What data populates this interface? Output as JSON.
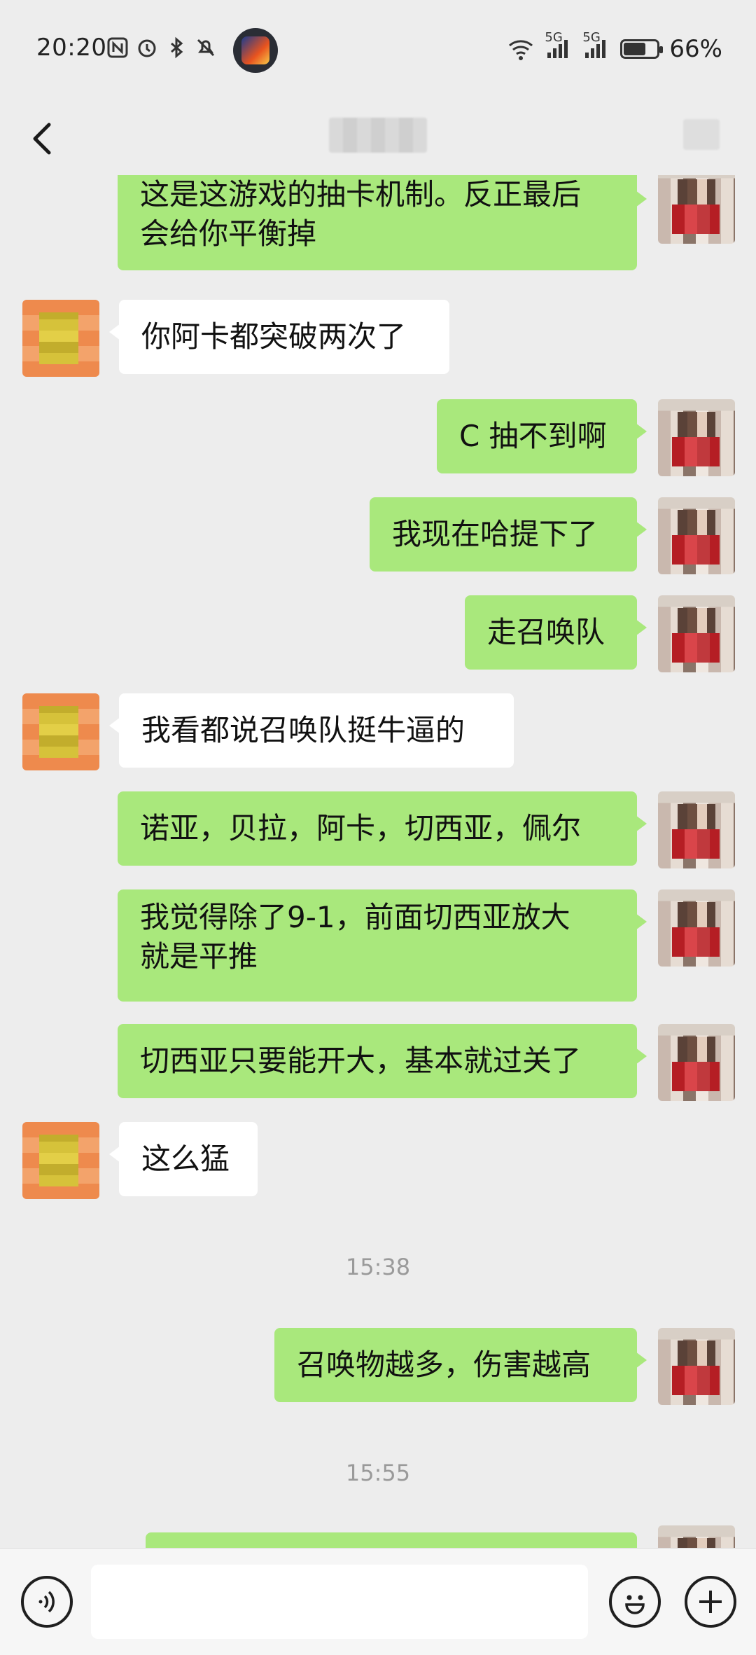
{
  "status_bar": {
    "time": "20:20",
    "battery": "66%",
    "battery_level": 0.66,
    "network_labels": [
      "5G",
      "5G"
    ],
    "icons": [
      "nfc-icon",
      "alarm-icon",
      "bluetooth-icon",
      "mute-icon",
      "wifi-icon",
      "signal-icon",
      "signal-icon",
      "battery-icon"
    ]
  },
  "header": {
    "title": "",
    "back_icon": "chevron-left-icon",
    "menu_icon": "more-icon"
  },
  "messages": [
    {
      "side": "out",
      "lines": [
        "这是这游戏的抽卡机制。反正最后",
        "会给你平衡掉"
      ]
    },
    {
      "side": "in",
      "lines": [
        "你阿卡都突破两次了"
      ]
    },
    {
      "side": "out",
      "lines": [
        "C 抽不到啊"
      ]
    },
    {
      "side": "out",
      "lines": [
        "我现在哈提下了"
      ]
    },
    {
      "side": "out",
      "lines": [
        "走召唤队"
      ]
    },
    {
      "side": "in",
      "lines": [
        "我看都说召唤队挺牛逼的"
      ]
    },
    {
      "side": "out",
      "lines": [
        "诺亚，贝拉，阿卡，切西亚，佩尔"
      ]
    },
    {
      "side": "out",
      "lines": [
        "我觉得除了9-1，前面切西亚放大",
        "就是平推"
      ]
    },
    {
      "side": "out",
      "lines": [
        "切西亚只要能开大，基本就过关了"
      ]
    },
    {
      "side": "in",
      "lines": [
        "这么猛"
      ]
    },
    {
      "side": "out",
      "lines": [
        "召唤物越多，伤害越高"
      ]
    }
  ],
  "timestamps": [
    "15:38",
    "15:55"
  ],
  "input_bar": {
    "placeholder": "",
    "voice_icon": "voice-icon",
    "emoji_icon": "emoji-icon",
    "plus_icon": "plus-icon"
  }
}
